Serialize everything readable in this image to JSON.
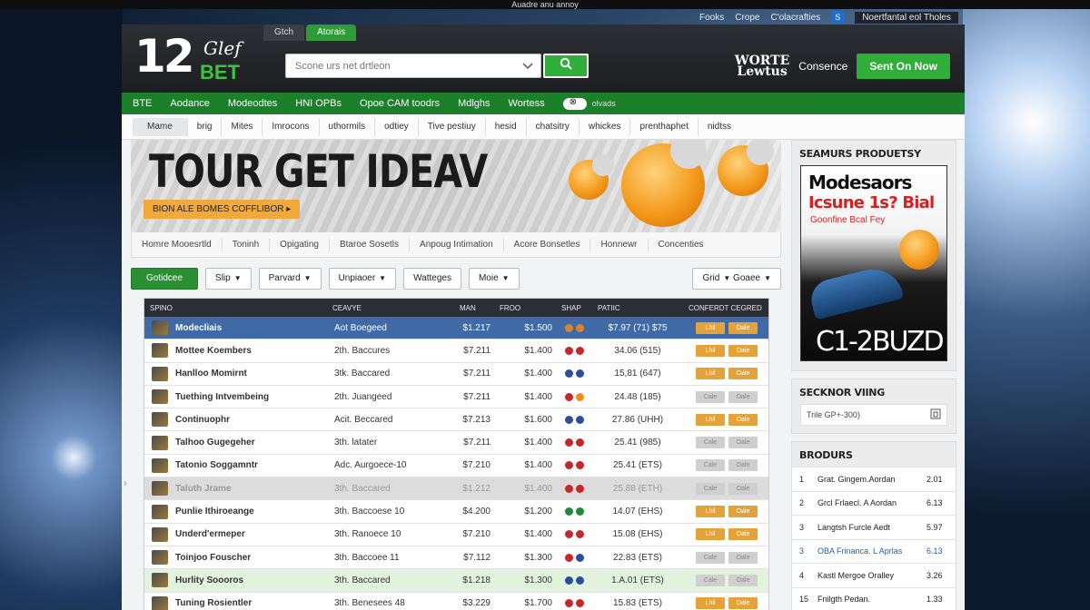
{
  "os_bar": {
    "text": "Auadre anu annoy"
  },
  "top_links": {
    "link1": "Fooks",
    "link2": "Crope",
    "link3": "C'olacrafties",
    "notice": "Noertfantal eol Tholes"
  },
  "header": {
    "top_tabs": [
      "Gtch",
      "Atorais"
    ],
    "logo_num": "12",
    "logo_top": "Glef",
    "logo_bet": "BET",
    "search_placeholder": "Scone urs net drtleon",
    "wordmark_line1": "WORTE",
    "wordmark_line2": "Lewtus",
    "consence": "Consence",
    "cta": "Sent On Now"
  },
  "green_nav": {
    "items": [
      "BTE",
      "Aodance",
      "Modeodtes",
      "HNI OPBs",
      "Opoe CAM toodrs",
      "Mdlghs",
      "Wortess"
    ],
    "toggle_label": "olvads"
  },
  "sub_nav": {
    "items": [
      "Mame",
      "brig",
      "Mites",
      "Imrocons",
      "uthormils",
      "odtiey",
      "Tive pestiuy",
      "hesid",
      "chatsitry",
      "whickes",
      "prenthaphet",
      "nidtss"
    ]
  },
  "hero": {
    "title": "TOUR GET IDEAV",
    "badge": "BION ALE BOMES COFFLIBOR ▸"
  },
  "categories": [
    "Homre Mooesrtld",
    "Toninh",
    "Opigating",
    "Btaroe Sosetls",
    "Anpoug Intimation",
    "Acore Bonsetles",
    "Honnewr",
    "Concenties"
  ],
  "filters": {
    "primary": "Gotidcee",
    "f1": "Slip",
    "f2": "Parvard",
    "f3": "Unpiaoer",
    "f4": "Watteges",
    "f5": "Moie",
    "right1": "Grid",
    "right2": "Goaee"
  },
  "table": {
    "headers": [
      "SPINO",
      "CEAVYE",
      "MAN",
      "FROO",
      "SHAP",
      "PATIIC",
      "CONFERDT CEGRED"
    ],
    "rows": [
      {
        "name": "Modecliais",
        "sub": "Aot Boegeed",
        "man": "$1.217",
        "frog": "$1.500",
        "ratio": "$7.97 (71) $75",
        "style": "highlight",
        "d1": "#d8842f",
        "d2": "#d8842f",
        "a1": "Lhil",
        "a2": "Oale",
        "on": true
      },
      {
        "name": "Mottee Koembers",
        "sub": "2th. Baccures",
        "man": "$7.211",
        "frog": "$1.400",
        "ratio": "34.06 (515)",
        "style": "",
        "d1": "#c62828",
        "d2": "#c62828",
        "a1": "Lhil",
        "a2": "Oale",
        "on": true
      },
      {
        "name": "Hanlloo Momirnt",
        "sub": "3tk. Baccared",
        "man": "$7.211",
        "frog": "$1.400",
        "ratio": "15,81 (647)",
        "style": "",
        "d1": "#2a4f9c",
        "d2": "#2a4f9c",
        "a1": "Lhil",
        "a2": "Oale",
        "on": true
      },
      {
        "name": "Tuething Intvembeing",
        "sub": "2th. Juangeed",
        "man": "$7.211",
        "frog": "$1.400",
        "ratio": "24.48 (185)",
        "style": "",
        "d1": "#c62828",
        "d2": "#ef8c1a",
        "a1": "Cale",
        "a2": "Oale",
        "on": false
      },
      {
        "name": "Continuophr",
        "sub": "Acit. Beccared",
        "man": "$7.213",
        "frog": "$1.600",
        "ratio": "27.86 (UHH)",
        "style": "",
        "d1": "#2a4f9c",
        "d2": "#2a4f9c",
        "a1": "Lhil",
        "a2": "Oale",
        "on": true
      },
      {
        "name": "Talhoo Gugegeher",
        "sub": "3th. latater",
        "man": "$7.211",
        "frog": "$1.400",
        "ratio": "25.41 (985)",
        "style": "",
        "d1": "#c62828",
        "d2": "#c62828",
        "a1": "Cale",
        "a2": "Oale",
        "on": false
      },
      {
        "name": "Tatonio Soggamntr",
        "sub": "Adc. Aurgoece-10",
        "man": "$7.210",
        "frog": "$1.400",
        "ratio": "25.41 (ETS)",
        "style": "",
        "d1": "#c62828",
        "d2": "#c62828",
        "a1": "Cale",
        "a2": "Oale",
        "on": false
      },
      {
        "name": "Taluth Jrame",
        "sub": "3th. Baccared",
        "man": "$1.212",
        "frog": "$1.400",
        "ratio": "25.88 (ETH)",
        "style": "dim",
        "d1": "#c62828",
        "d2": "#c62828",
        "a1": "Cale",
        "a2": "Oale",
        "on": false
      },
      {
        "name": "Punlie Ithiroeange",
        "sub": "3th. Baccoese 10",
        "man": "$4.200",
        "frog": "$1.200",
        "ratio": "14.07 (EHS)",
        "style": "",
        "d1": "#1e8a3a",
        "d2": "#1e8a3a",
        "a1": "Lhil",
        "a2": "Oale",
        "on": true
      },
      {
        "name": "Underd'ermeper",
        "sub": "3th. Ranoece 10",
        "man": "$7.210",
        "frog": "$1.400",
        "ratio": "15.08 (EHS)",
        "style": "",
        "d1": "#c62828",
        "d2": "#c62828",
        "a1": "Lhil",
        "a2": "Oale",
        "on": true
      },
      {
        "name": "Toinjoo Fouscher",
        "sub": "3th. Baccoee 11",
        "man": "$7.112",
        "frog": "$1.300",
        "ratio": "22.83 (ETS)",
        "style": "",
        "d1": "#c62828",
        "d2": "#2a4f9c",
        "a1": "Cale",
        "a2": "Oale",
        "on": false
      },
      {
        "name": "Hurlity Soooros",
        "sub": "3th. Baccared",
        "man": "$1.218",
        "frog": "$1.300",
        "ratio": "1.A.01 (ETS)",
        "style": "green",
        "d1": "#2a4f9c",
        "d2": "#2a4f9c",
        "a1": "Cale",
        "a2": "Oale",
        "on": false
      },
      {
        "name": "Tuning Rosientler",
        "sub": "3th. Benesees 48",
        "man": "$3.229",
        "frog": "$1.700",
        "ratio": "15.83 (ETS)",
        "style": "",
        "d1": "#c62828",
        "d2": "#c62828",
        "a1": "Lhil",
        "a2": "Oale",
        "on": true
      }
    ]
  },
  "sidebar": {
    "promo_head": "SEAMURS PRODUETSY",
    "promo_title": "Modesaors",
    "promo_sub": "Icsune 1s? Bial",
    "promo_line": "Goonfine Bcal Fey",
    "promo_price": "C1-2BUZD",
    "viewing_head": "SECKNOR VIING",
    "viewing_text": "Trile GP+-300)",
    "rank_head": "BRODURS",
    "ranks": [
      {
        "n": "1",
        "name": "Grat. Gingem.Aordan",
        "val": "2.01",
        "blue": false
      },
      {
        "n": "2",
        "name": "Grcl Frlaecl. A Aordan",
        "val": "6.13",
        "blue": false
      },
      {
        "n": "3",
        "name": "Langtsh Furcle Aedt",
        "val": "5.97",
        "blue": false
      },
      {
        "n": "3",
        "name": "OBA Frinanca. L Aprlas",
        "val": "6.13",
        "blue": true
      },
      {
        "n": "4",
        "name": "Kastl Mergoe Oralley",
        "val": "3.26",
        "blue": false
      },
      {
        "n": "15",
        "name": "Fnilgth Pedan.",
        "val": "1.33",
        "blue": false
      }
    ]
  }
}
